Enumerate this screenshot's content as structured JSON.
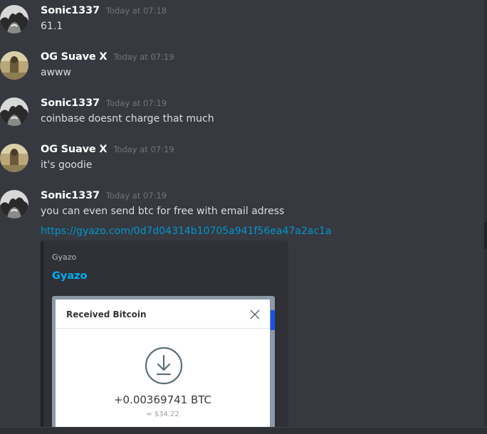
{
  "messages": [
    {
      "author": "Sonic1337",
      "avatar": "sonic-avatar",
      "timestamp": "Today at 07:18",
      "content": "61.1"
    },
    {
      "author": "OG Suave X",
      "avatar": "suave-avatar",
      "timestamp": "Today at 07:19",
      "content": "awww"
    },
    {
      "author": "Sonic1337",
      "avatar": "sonic-avatar",
      "timestamp": "Today at 07:19",
      "content": "coinbase doesnt charge that much"
    },
    {
      "author": "OG Suave X",
      "avatar": "suave-avatar",
      "timestamp": "Today at 07:19",
      "content": "it's goodie"
    },
    {
      "author": "Sonic1337",
      "avatar": "sonic-avatar",
      "timestamp": "Today at 07:19",
      "content": "you can even send btc for free with email adress"
    }
  ],
  "link": {
    "text": "https://gyazo.com/0d7d04314b10705a941f56ea47a2ac1a"
  },
  "embed": {
    "provider": "Gyazo",
    "title": "Gyazo",
    "image": {
      "dialog_title": "Received Bitcoin",
      "close_icon": "close-icon",
      "download_icon": "download-circle-icon",
      "amount": "+0.00369741 BTC",
      "usd": "≈ $34.22"
    }
  },
  "colors": {
    "background": "#36393f",
    "link": "#0096cf",
    "embed_title": "#00b0f4",
    "timestamp": "#72767d"
  }
}
